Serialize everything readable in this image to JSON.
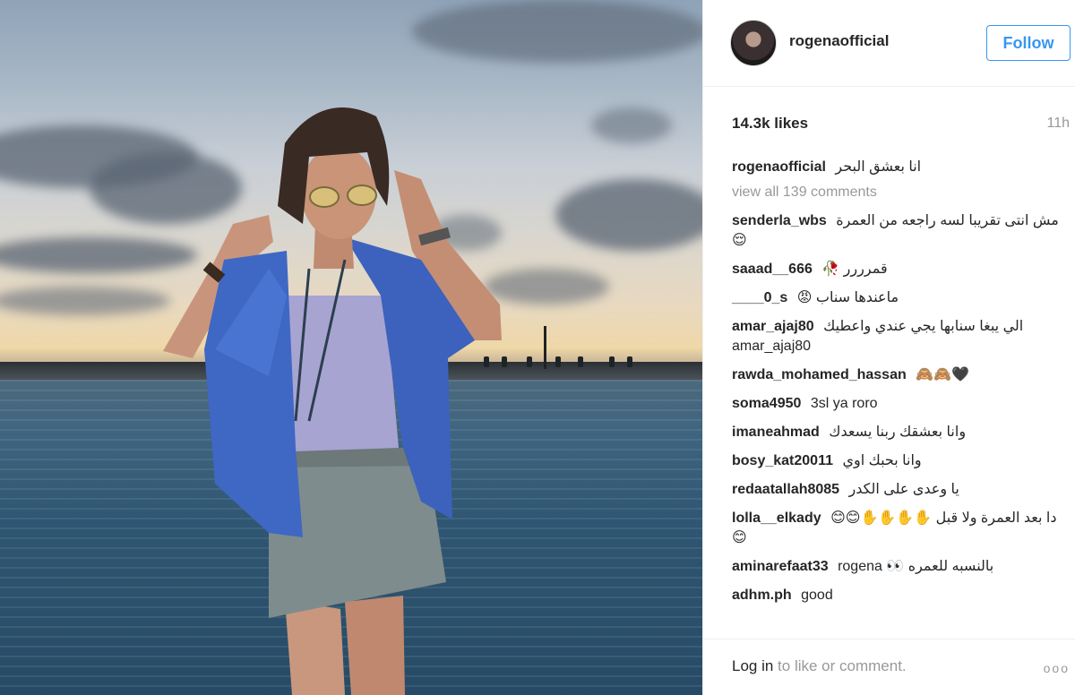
{
  "post": {
    "image_alt": "",
    "username": "rogenaofficial",
    "follow_label": "Follow",
    "likes": "14.3k likes",
    "age": "11h",
    "caption": "انا بعشق البحر",
    "view_all": "view all 139 comments",
    "comments": [
      {
        "user": "senderla_wbs",
        "text": "مش انتى تقريبا لسه راجعه من العمرة 😌"
      },
      {
        "user": "saaad__666",
        "text": "قمرررر 🥀"
      },
      {
        "user": "____0_s",
        "text": "ماعندها سناب 😡"
      },
      {
        "user": "amar_ajaj80",
        "text": "الي يبغا سنابها يجي عندي واعطيك amar_ajaj80"
      },
      {
        "user": "rawda_mohamed_hassan",
        "text": "🙈🙈🖤"
      },
      {
        "user": "soma4950",
        "text": "3sl ya roro"
      },
      {
        "user": "imaneahmad",
        "text": "وانا بعشقك ربنا يسعدك"
      },
      {
        "user": "bosy_kat20011",
        "text": "وانا بحبك اوي"
      },
      {
        "user": "redaatallah8085",
        "text": "يا وعدى على الكدر"
      },
      {
        "user": "lolla__elkady",
        "text": "دا بعد العمرة ولا قبل ✋✋✋✋😊😊😊"
      },
      {
        "user": "aminarefaat33",
        "text": "بالنسبه للعمره 👀 rogena"
      },
      {
        "user": "adhm.ph",
        "text": "good"
      }
    ],
    "login_link": "Log in",
    "login_rest": " to like or comment.",
    "more_label": "ooo"
  },
  "colors": {
    "accent": "#3897f0",
    "muted": "#999999",
    "text": "#262626"
  }
}
